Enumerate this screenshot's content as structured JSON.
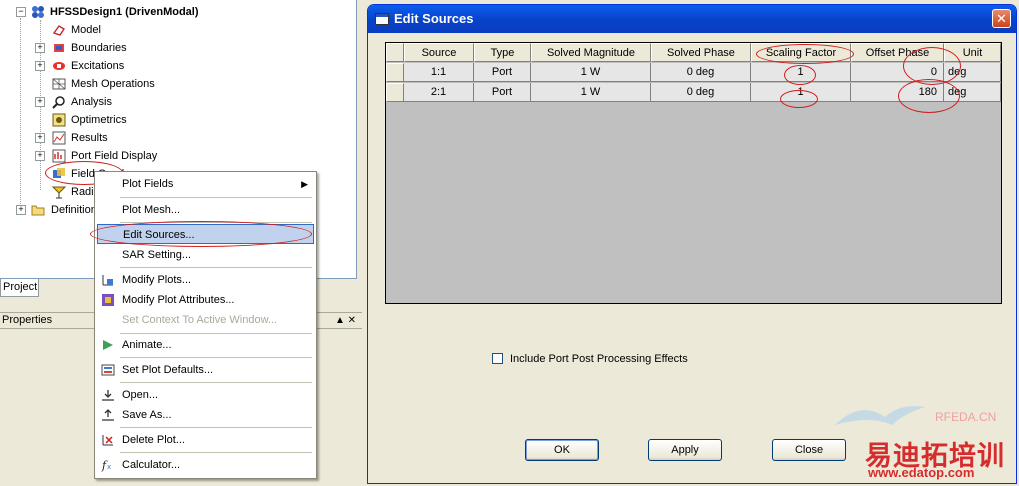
{
  "tree": {
    "root": "HFSSDesign1 (DrivenModal)",
    "items": [
      {
        "label": "Model",
        "icon": "model-icon",
        "expandable": false
      },
      {
        "label": "Boundaries",
        "icon": "boundaries-icon",
        "expandable": true
      },
      {
        "label": "Excitations",
        "icon": "excitations-icon",
        "expandable": true
      },
      {
        "label": "Mesh Operations",
        "icon": "mesh-operations-icon",
        "expandable": false
      },
      {
        "label": "Analysis",
        "icon": "analysis-icon",
        "expandable": true
      },
      {
        "label": "Optimetrics",
        "icon": "optimetrics-icon",
        "expandable": false
      },
      {
        "label": "Results",
        "icon": "results-icon",
        "expandable": true
      },
      {
        "label": "Port Field Display",
        "icon": "port-field-display-icon",
        "expandable": true
      },
      {
        "label": "Field Overlays",
        "icon": "field-overlays-icon",
        "expandable": false
      },
      {
        "label": "Radiation",
        "icon": "radiation-icon",
        "expandable": false
      }
    ],
    "definitions": "Definitions"
  },
  "project_tab": "Project",
  "properties_title": "Properties",
  "properties_controls": "▲ ✕",
  "context_menu": {
    "items": [
      {
        "label": "Plot Fields",
        "icon": "",
        "submenu": true
      },
      {
        "label": "Plot Mesh...",
        "icon": ""
      },
      {
        "label": "Edit Sources...",
        "icon": ""
      },
      {
        "label": "SAR Setting...",
        "icon": ""
      },
      {
        "label": "Modify Plots...",
        "icon": "modify-plots-icon"
      },
      {
        "label": "Modify Plot Attributes...",
        "icon": "modify-plot-attributes-icon"
      },
      {
        "label": "Set Context To Active Window...",
        "icon": "",
        "disabled": true
      },
      {
        "label": "Animate...",
        "icon": "animate-icon"
      },
      {
        "label": "Set Plot Defaults...",
        "icon": "set-plot-defaults-icon"
      },
      {
        "label": "Open...",
        "icon": "open-icon"
      },
      {
        "label": "Save As...",
        "icon": "save-as-icon"
      },
      {
        "label": "Delete Plot...",
        "icon": "delete-plot-icon"
      },
      {
        "label": "Calculator...",
        "icon": "calculator-icon"
      }
    ],
    "submenu_arrow": "▶"
  },
  "dialog": {
    "title": "Edit Sources",
    "close_glyph": "✕",
    "columns": [
      "Source",
      "Type",
      "Solved Magnitude",
      "Solved Phase",
      "Scaling Factor",
      "Offset Phase",
      "Unit"
    ],
    "rows": [
      {
        "source": "1:1",
        "type": "Port",
        "solved_magnitude": "1 W",
        "solved_phase": "0 deg",
        "scaling_factor": "1",
        "offset_phase": "0",
        "unit": "deg"
      },
      {
        "source": "2:1",
        "type": "Port",
        "solved_magnitude": "1 W",
        "solved_phase": "0 deg",
        "scaling_factor": "1",
        "offset_phase": "180",
        "unit": "deg"
      }
    ],
    "checkbox_label": "Include Port Post Processing Effects",
    "checkbox_checked": false,
    "ok_label": "OK",
    "apply_label": "Apply",
    "close_label": "Close"
  },
  "watermark": {
    "site": "RFEDA.CN",
    "brand": "易迪拓培训",
    "url": "www.edatop.com"
  },
  "colors": {
    "title_bar": "#0a5fee",
    "menu_highlight": "#c1d2ee",
    "annotation": "#d21c1c",
    "watermark_red": "#d62c2c"
  }
}
